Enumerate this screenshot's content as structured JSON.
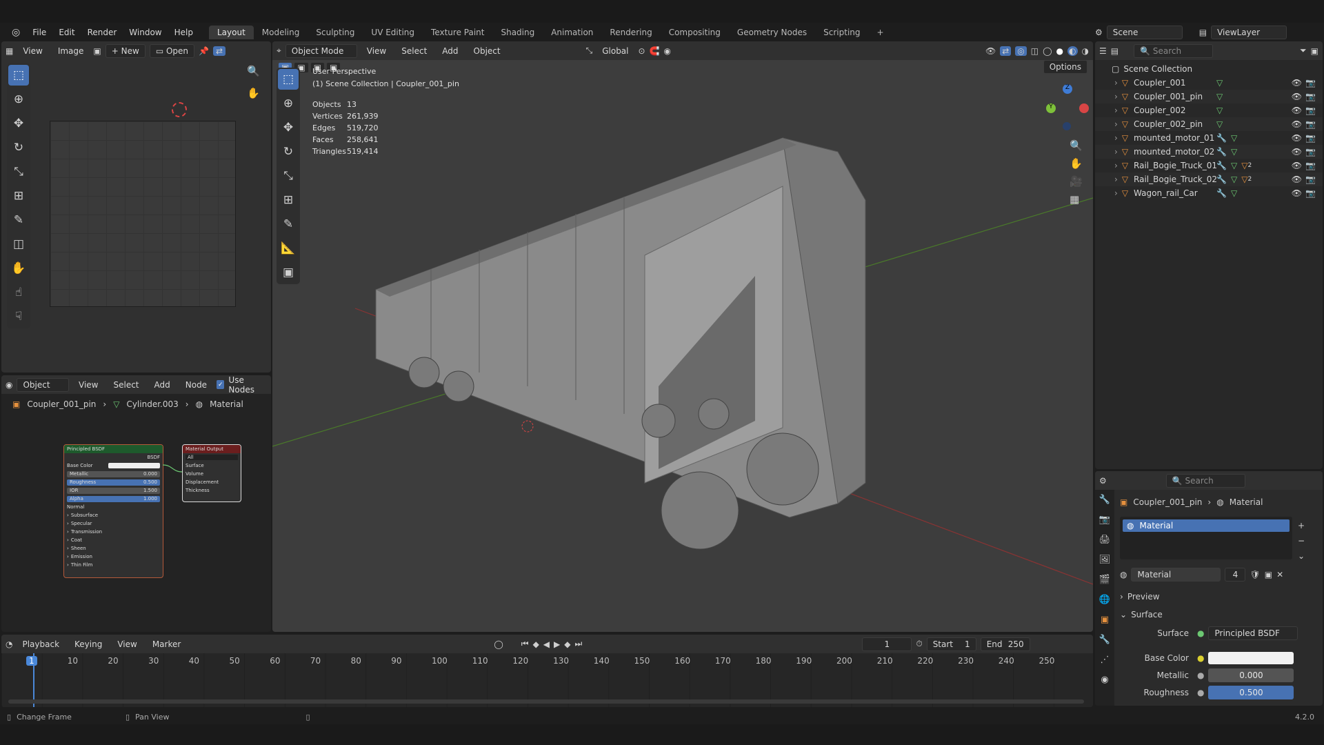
{
  "menubar": {
    "file": "File",
    "edit": "Edit",
    "render": "Render",
    "window": "Window",
    "help": "Help"
  },
  "workspaces": [
    "Layout",
    "Modeling",
    "Sculpting",
    "UV Editing",
    "Texture Paint",
    "Shading",
    "Animation",
    "Rendering",
    "Compositing",
    "Geometry Nodes",
    "Scripting"
  ],
  "scene": {
    "name": "Scene",
    "view_layer": "ViewLayer"
  },
  "image_editor": {
    "view": "View",
    "image": "Image",
    "new": "New",
    "open": "Open"
  },
  "viewport": {
    "mode": "Object Mode",
    "view": "View",
    "select": "Select",
    "add": "Add",
    "object": "Object",
    "orientation": "Global",
    "options": "Options",
    "perspective": "User Perspective",
    "collection_info": "(1) Scene Collection | Coupler_001_pin",
    "stats": [
      {
        "label": "Objects",
        "value": "13"
      },
      {
        "label": "Vertices",
        "value": "261,939"
      },
      {
        "label": "Edges",
        "value": "519,720"
      },
      {
        "label": "Faces",
        "value": "258,641"
      },
      {
        "label": "Triangles",
        "value": "519,414"
      }
    ],
    "gizmo": {
      "x": "X",
      "y": "Y",
      "z": "Z"
    }
  },
  "node_editor": {
    "type": "Object",
    "view": "View",
    "select": "Select",
    "add": "Add",
    "node": "Node",
    "use_nodes": "Use Nodes",
    "crumb_object": "Coupler_001_pin",
    "crumb_mesh": "Cylinder.003",
    "crumb_material": "Material",
    "bsdf": {
      "title": "Principled BSDF",
      "out": "BSDF",
      "base_color": "Base Color",
      "rows": [
        {
          "label": "Metallic",
          "value": "0.000"
        },
        {
          "label": "Roughness",
          "value": "0.500"
        },
        {
          "label": "IOR",
          "value": "1.500"
        },
        {
          "label": "Alpha",
          "value": "1.000"
        }
      ],
      "normal": "Normal",
      "subs": [
        "Subsurface",
        "Specular",
        "Transmission",
        "Coat",
        "Sheen",
        "Emission",
        "Thin Film"
      ]
    },
    "output": {
      "title": "Material Output",
      "target": "All",
      "inputs": [
        "Surface",
        "Volume",
        "Displacement",
        "Thickness"
      ]
    }
  },
  "timeline": {
    "playback": "Playback",
    "keying": "Keying",
    "view": "View",
    "marker": "Marker",
    "current": "1",
    "start_label": "Start",
    "start": "1",
    "end_label": "End",
    "end": "250",
    "ticks": [
      "1",
      "10",
      "20",
      "30",
      "40",
      "50",
      "60",
      "70",
      "80",
      "90",
      "100",
      "110",
      "120",
      "130",
      "140",
      "150",
      "160",
      "170",
      "180",
      "190",
      "200",
      "210",
      "220",
      "230",
      "240",
      "250"
    ]
  },
  "outliner": {
    "search": "Search",
    "collection": "Scene Collection",
    "items": [
      {
        "name": "Coupler_001"
      },
      {
        "name": "Coupler_001_pin"
      },
      {
        "name": "Coupler_002"
      },
      {
        "name": "Coupler_002_pin"
      },
      {
        "name": "mounted_motor_01"
      },
      {
        "name": "mounted_motor_02"
      },
      {
        "name": "Rail_Bogie_Truck_01",
        "count": "2"
      },
      {
        "name": "Rail_Bogie_Truck_02",
        "count": "2"
      },
      {
        "name": "Wagon_rail_Car"
      }
    ]
  },
  "properties": {
    "search": "Search",
    "crumb_object": "Coupler_001_pin",
    "crumb_material": "Material",
    "slot": "Material",
    "material_name": "Material",
    "users": "4",
    "preview": "Preview",
    "surface_section": "Surface",
    "surface_label": "Surface",
    "surface_value": "Principled BSDF",
    "base_color": "Base Color",
    "metallic_label": "Metallic",
    "metallic": "0.000",
    "roughness_label": "Roughness",
    "roughness": "0.500"
  },
  "statusbar": {
    "change_frame": "Change Frame",
    "pan_view": "Pan View",
    "version": "4.2.0"
  }
}
